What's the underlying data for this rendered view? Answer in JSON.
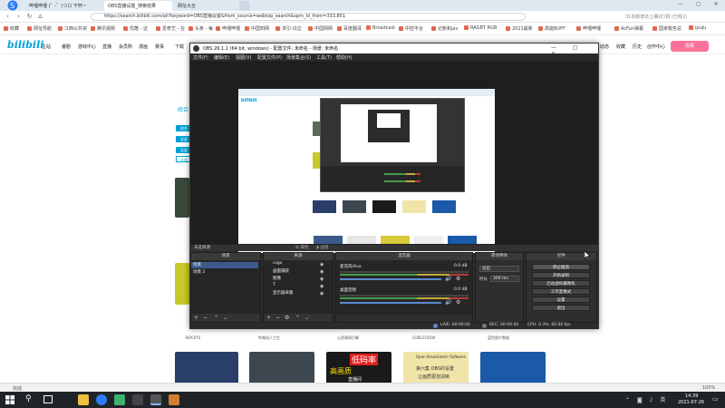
{
  "browser": {
    "tabs": [
      {
        "label": "哔哩哔哩 (゜-゜)つロ 干杯~"
      },
      {
        "label": "OBS直播设置_搜索结果"
      },
      {
        "label": "网址大全"
      }
    ],
    "url": "https://search.bilibili.com/all?keyword=OBS直播设置&from_source=webtop_search&spm_id_from=333.851",
    "addr_right": "31省新增本土确诊1例 (已经2)",
    "bookmarks": [
      "收藏",
      "网址导航",
      "江西公共资",
      "腾讯视频",
      "优酷 - 这",
      "爱奇艺 - 在",
      "头条 - 每",
      "哔哩哔哩",
      "中国知网",
      "求引·识边",
      "中国网网",
      "百度翻译",
      "Broadcast",
      "中控平台",
      "记账和jav",
      "RAGBT RGB",
      "2021最新",
      "高能BUFF",
      "哔哩哔哩",
      "AcFun弹幕",
      "国家税务总",
      "ipuju"
    ],
    "status_text": "完成",
    "zoom_text": "100%"
  },
  "bili": {
    "logo": "bilibili",
    "nav": [
      "主站",
      "番剧",
      "游戏中心",
      "直播",
      "会员购",
      "漫画",
      "赛事",
      "下载"
    ],
    "nav_right": [
      "动态",
      "收藏",
      "历史",
      "创作中心"
    ],
    "upload_label": "投稿",
    "side_heading": "综合",
    "side_tags": [
      "综合",
      "全部",
      "全部",
      "全部"
    ],
    "row_titles": [
      "BOCEYS",
      "哔哩站人工生",
      "心愿青铜引擎",
      "SUBLOCKSW",
      "蓝色图片数据"
    ],
    "thumb_texts": [
      "低码率",
      "高画质",
      "直播间",
      "视频编码",
      "Open Broadcaster Software",
      "第六集 OBS的设置",
      "让画质更加清晰"
    ]
  },
  "obs": {
    "title": "OBS 26.1.1 (64 bit, windows) - 配置文件: 未命名 - 场景: 未命名",
    "menu": [
      "文件(F)",
      "编辑(E)",
      "视图(V)",
      "配置文件(P)",
      "场景集合(S)",
      "工具(T)",
      "帮助(H)"
    ],
    "strip_left": "未选择源",
    "strip_props": "属性",
    "strip_filters": "滤镜",
    "docks": {
      "scenes": {
        "title": "场景",
        "items": [
          "场景",
          "场景 2"
        ]
      },
      "sources": {
        "title": "来源",
        "items": [
          "csgo",
          "画面捕获",
          "图像",
          "T",
          "显示器采集"
        ]
      },
      "mixer": {
        "title": "混音器",
        "channels": [
          {
            "name": "麦克风/Aux",
            "db": "0.0 dB"
          },
          {
            "name": "桌面音频",
            "db": "0.0 dB"
          }
        ]
      },
      "transitions": {
        "title": "转场特效",
        "type": "淡出",
        "duration_label": "时长",
        "duration": "300 ms"
      },
      "controls": {
        "title": "控件",
        "buttons": [
          "停止推流",
          "开始录制",
          "启动虚拟摄像机",
          "工作室模式",
          "设置",
          "退出"
        ]
      }
    },
    "status": {
      "live": "LIVE: 00:00:00",
      "rec": "REC: 00:00:00",
      "cpu": "CPU: 0.3%, 60.00 fps"
    }
  },
  "taskbar": {
    "time": "14:39",
    "date": "2021-07-26"
  },
  "colors": {
    "bili_blue": "#00a1d6",
    "bili_pink": "#fb7299",
    "obs_bg": "#2c2c2c"
  }
}
